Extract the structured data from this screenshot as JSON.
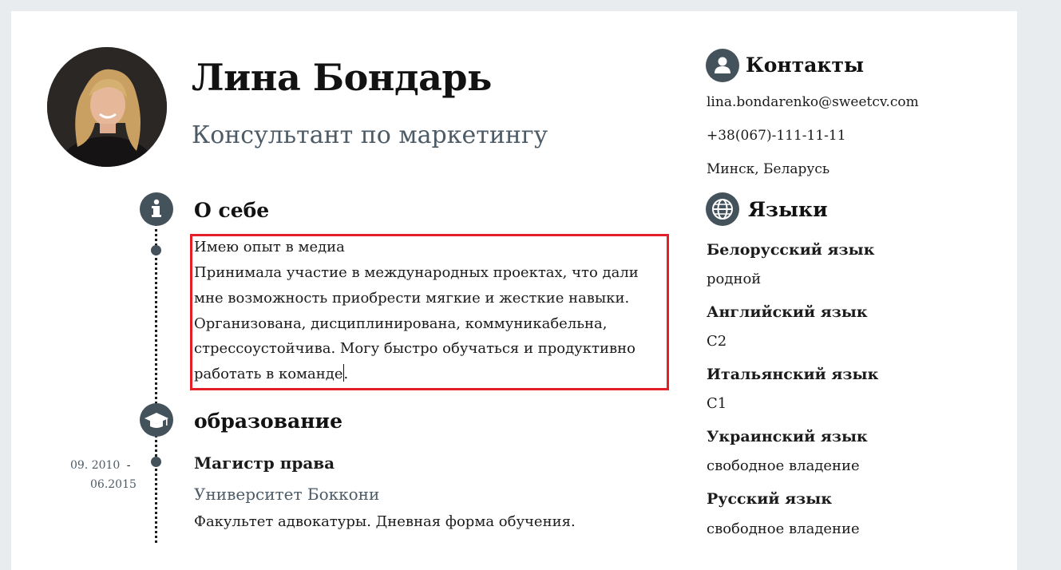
{
  "profile": {
    "name": "Лина Бондарь",
    "title": "Консультант по маркетингу"
  },
  "about": {
    "heading": "О себе",
    "lines": [
      "Имею опыт в медиа",
      "Принимала участие в международных проектах, что дали",
      "мне возможность приобрести мягкие и жесткие навыки.",
      "Организована, дисциплинирована, коммуникабельна,",
      "стрессоустойчива. Могу быстро обучаться и продуктивно",
      "работать в команде",
      "."
    ]
  },
  "education": {
    "heading": "образование",
    "items": [
      {
        "date_start": "09. 2010",
        "date_sep": "-",
        "date_end": "06.2015",
        "degree": "Магистр права",
        "school": "Университет Боккони",
        "description": "Факультет адвокатуры. Дневная форма обучения."
      }
    ]
  },
  "contacts": {
    "heading": "Контакты",
    "email": "lina.bondarenko@sweetcv.com",
    "phone": "+38(067)-111-11-11",
    "location": "Минск, Беларусь"
  },
  "languages": {
    "heading": "Языки",
    "items": [
      {
        "name": "Белорусский язык",
        "level": "родной"
      },
      {
        "name": "Английский язык",
        "level": "С2"
      },
      {
        "name": "Итальянский язык",
        "level": "С1"
      },
      {
        "name": "Украинский язык",
        "level": "свободное владение"
      },
      {
        "name": "Русский язык",
        "level": "свободное владение"
      }
    ]
  },
  "icons": {
    "about": "info-icon",
    "education": "graduation-cap-icon",
    "contacts": "user-icon",
    "languages": "globe-icon"
  },
  "colors": {
    "accent": "#44525c",
    "highlight_border": "#e3202a"
  }
}
